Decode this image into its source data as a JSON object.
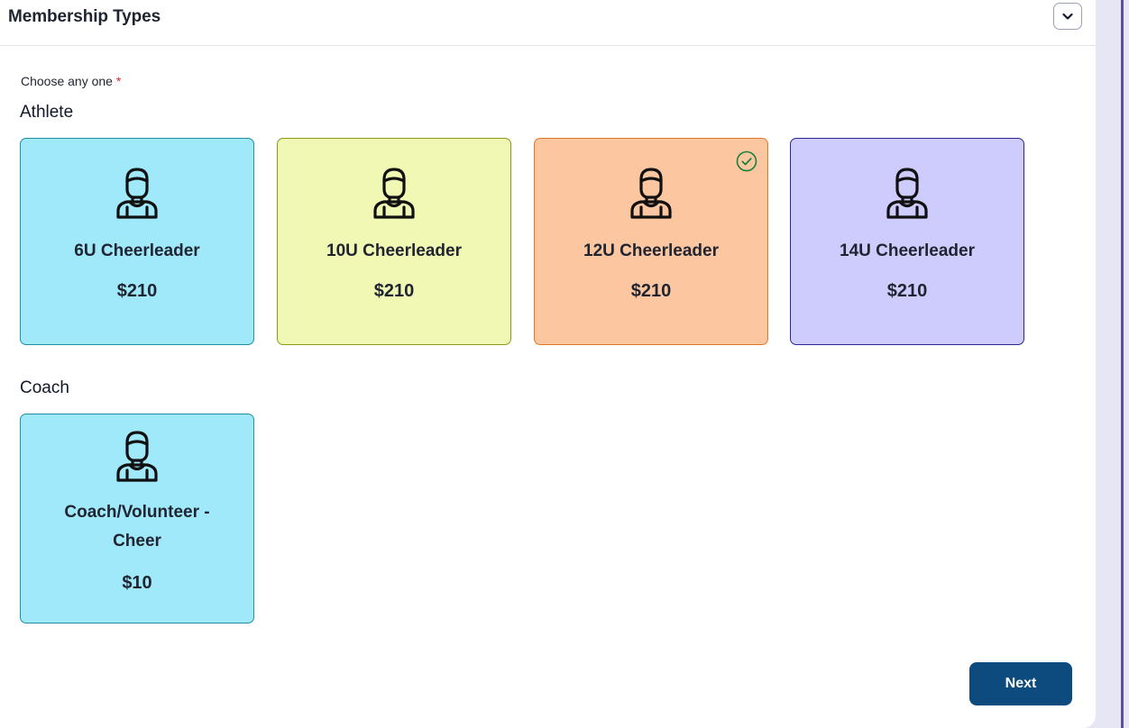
{
  "header": {
    "title": "Membership Types",
    "collapse_icon": "chevron-down-icon"
  },
  "form": {
    "choose_label": "Choose any one",
    "required_marker": "*"
  },
  "sections": [
    {
      "title": "Athlete",
      "cards": [
        {
          "name": "6U Cheerleader",
          "price": "$210",
          "bg": "#9fe9fb",
          "border": "#1f8fa6",
          "selected": false,
          "icon": "person-icon"
        },
        {
          "name": "10U Cheerleader",
          "price": "$210",
          "bg": "#f0f8b3",
          "border": "#8a9a1a",
          "selected": false,
          "icon": "person-icon"
        },
        {
          "name": "12U Cheerleader",
          "price": "$210",
          "bg": "#fcc6a1",
          "border": "#e0782a",
          "selected": true,
          "icon": "person-icon"
        },
        {
          "name": "14U Cheerleader",
          "price": "$210",
          "bg": "#cdccfd",
          "border": "#2b2790",
          "selected": false,
          "icon": "person-icon"
        }
      ]
    },
    {
      "title": "Coach",
      "cards": [
        {
          "name_line1": "Coach/Volunteer -",
          "name_line2": "Cheer",
          "price": "$10",
          "bg": "#9fe9fb",
          "border": "#1f8fa6",
          "selected": false,
          "icon": "person-icon"
        }
      ]
    }
  ],
  "footer": {
    "next_label": "Next"
  },
  "colors": {
    "selected_check": "#15803d",
    "primary_button": "#0d4a7e",
    "required": "#dc2626"
  }
}
